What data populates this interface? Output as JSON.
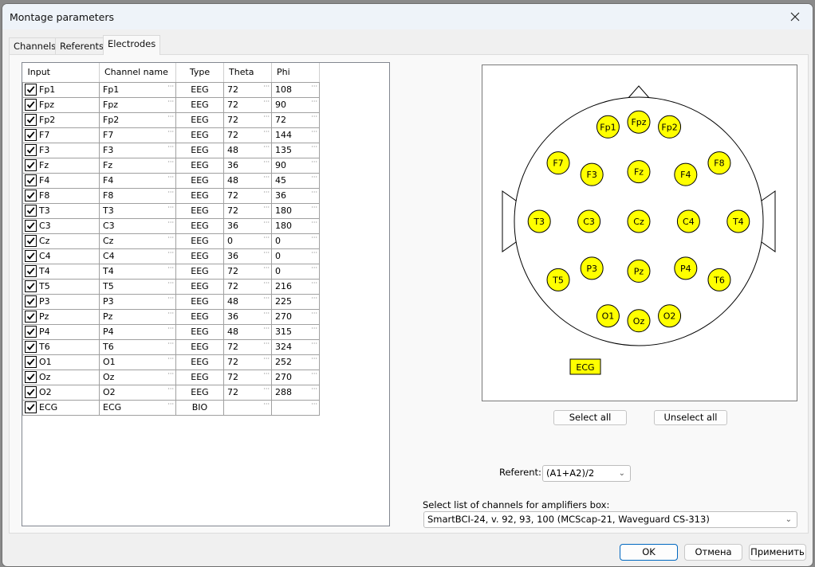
{
  "window": {
    "title": "Montage parameters",
    "close_icon": "close-icon"
  },
  "tabs": [
    {
      "label": "Channels",
      "active": false
    },
    {
      "label": "Referents",
      "active": false
    },
    {
      "label": "Electrodes",
      "active": true
    }
  ],
  "grid": {
    "columns": [
      "Input",
      "Channel name",
      "Type",
      "Theta",
      "Phi"
    ],
    "rows": [
      {
        "checked": true,
        "input": "Fp1",
        "name": "Fp1",
        "type": "EEG",
        "theta": "72",
        "phi": "108"
      },
      {
        "checked": true,
        "input": "Fpz",
        "name": "Fpz",
        "type": "EEG",
        "theta": "72",
        "phi": "90"
      },
      {
        "checked": true,
        "input": "Fp2",
        "name": "Fp2",
        "type": "EEG",
        "theta": "72",
        "phi": "72"
      },
      {
        "checked": true,
        "input": "F7",
        "name": "F7",
        "type": "EEG",
        "theta": "72",
        "phi": "144"
      },
      {
        "checked": true,
        "input": "F3",
        "name": "F3",
        "type": "EEG",
        "theta": "48",
        "phi": "135"
      },
      {
        "checked": true,
        "input": "Fz",
        "name": "Fz",
        "type": "EEG",
        "theta": "36",
        "phi": "90"
      },
      {
        "checked": true,
        "input": "F4",
        "name": "F4",
        "type": "EEG",
        "theta": "48",
        "phi": "45"
      },
      {
        "checked": true,
        "input": "F8",
        "name": "F8",
        "type": "EEG",
        "theta": "72",
        "phi": "36"
      },
      {
        "checked": true,
        "input": "T3",
        "name": "T3",
        "type": "EEG",
        "theta": "72",
        "phi": "180"
      },
      {
        "checked": true,
        "input": "C3",
        "name": "C3",
        "type": "EEG",
        "theta": "36",
        "phi": "180"
      },
      {
        "checked": true,
        "input": "Cz",
        "name": "Cz",
        "type": "EEG",
        "theta": "0",
        "phi": "0"
      },
      {
        "checked": true,
        "input": "C4",
        "name": "C4",
        "type": "EEG",
        "theta": "36",
        "phi": "0"
      },
      {
        "checked": true,
        "input": "T4",
        "name": "T4",
        "type": "EEG",
        "theta": "72",
        "phi": "0"
      },
      {
        "checked": true,
        "input": "T5",
        "name": "T5",
        "type": "EEG",
        "theta": "72",
        "phi": "216"
      },
      {
        "checked": true,
        "input": "P3",
        "name": "P3",
        "type": "EEG",
        "theta": "48",
        "phi": "225"
      },
      {
        "checked": true,
        "input": "Pz",
        "name": "Pz",
        "type": "EEG",
        "theta": "36",
        "phi": "270"
      },
      {
        "checked": true,
        "input": "P4",
        "name": "P4",
        "type": "EEG",
        "theta": "48",
        "phi": "315"
      },
      {
        "checked": true,
        "input": "T6",
        "name": "T6",
        "type": "EEG",
        "theta": "72",
        "phi": "324"
      },
      {
        "checked": true,
        "input": "O1",
        "name": "O1",
        "type": "EEG",
        "theta": "72",
        "phi": "252"
      },
      {
        "checked": true,
        "input": "Oz",
        "name": "Oz",
        "type": "EEG",
        "theta": "72",
        "phi": "270"
      },
      {
        "checked": true,
        "input": "O2",
        "name": "O2",
        "type": "EEG",
        "theta": "72",
        "phi": "288"
      },
      {
        "checked": true,
        "input": "ECG",
        "name": "ECG",
        "type": "BIO",
        "theta": "",
        "phi": ""
      }
    ]
  },
  "head_map": {
    "electrode_color": "#ffff00",
    "electrodes": [
      "Fp1",
      "Fpz",
      "Fp2",
      "F7",
      "F3",
      "Fz",
      "F4",
      "F8",
      "T3",
      "C3",
      "Cz",
      "C4",
      "T4",
      "T5",
      "P3",
      "Pz",
      "P4",
      "T6",
      "O1",
      "Oz",
      "O2"
    ],
    "extra_channel": "ECG"
  },
  "buttons": {
    "select_all": "Select all",
    "unselect_all": "Unselect all"
  },
  "referent": {
    "label": "Referent:",
    "value": "(A1+A2)/2"
  },
  "amplifier": {
    "label": "Select list of channels for amplifiers box:",
    "value": "SmartBCI-24, v. 92, 93, 100 (MCScap-21, Waveguard CS-313)"
  },
  "footer": {
    "ok": "OK",
    "cancel": "Отмена",
    "apply": "Применить"
  }
}
